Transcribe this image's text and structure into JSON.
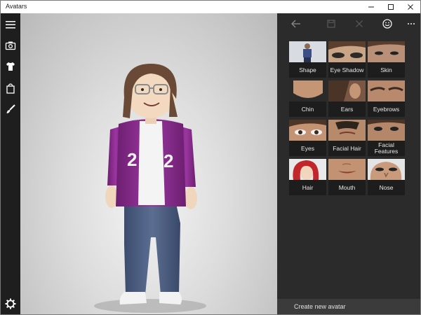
{
  "window": {
    "title": "Avatars"
  },
  "sidebar": {
    "items": [
      {
        "icon": "hamburger-menu-icon"
      },
      {
        "icon": "camera-icon"
      },
      {
        "icon": "shirt-icon"
      },
      {
        "icon": "shopping-bag-icon"
      },
      {
        "icon": "paintbrush-icon"
      }
    ],
    "settings_icon": "gear-icon"
  },
  "toolbar": {
    "items": [
      "back-arrow-icon",
      "save-icon",
      "close-icon",
      "smiley-icon",
      "more-icon"
    ]
  },
  "features": {
    "tiles": [
      {
        "label": "Shape"
      },
      {
        "label": "Eye Shadow"
      },
      {
        "label": "Skin"
      },
      {
        "label": "Chin"
      },
      {
        "label": "Ears"
      },
      {
        "label": "Eyebrows"
      },
      {
        "label": "Eyes"
      },
      {
        "label": "Facial Hair"
      },
      {
        "label": "Facial Features"
      },
      {
        "label": "Hair"
      },
      {
        "label": "Mouth"
      },
      {
        "label": "Nose"
      }
    ]
  },
  "footer": {
    "create_label": "Create new avatar"
  },
  "colors": {
    "sidebar": "#1e1e1e",
    "panel": "#2b2b2b",
    "jacket": "#8a2a8e"
  }
}
